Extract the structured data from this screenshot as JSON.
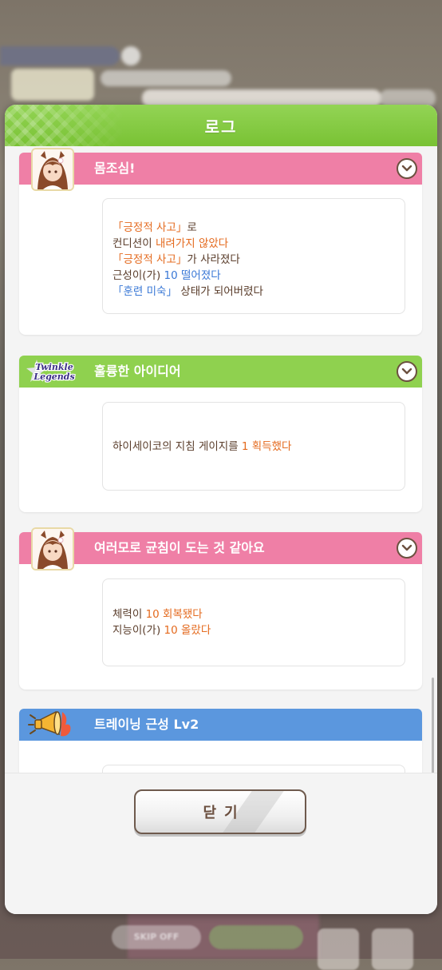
{
  "background": {
    "top_label": "목표",
    "skip_label": "SKIP OFF"
  },
  "modal": {
    "title": "로그",
    "close_label": "닫기"
  },
  "entries": [
    {
      "color": "pink",
      "icon": "character-portrait-icon",
      "title": "몸조심!",
      "lines": [
        [
          {
            "t": "「긍정적 사고」",
            "c": "o"
          },
          {
            "t": "로",
            "c": ""
          }
        ],
        [
          {
            "t": "컨디션이 ",
            "c": ""
          },
          {
            "t": "내려가지 않았다",
            "c": "o"
          }
        ],
        [
          {
            "t": "「긍정적 사고」",
            "c": "o"
          },
          {
            "t": "가 사라졌다",
            "c": ""
          }
        ],
        [
          {
            "t": "근성이(가) ",
            "c": ""
          },
          {
            "t": "10 떨어졌다",
            "c": "b"
          }
        ],
        [
          {
            "t": "「훈련 미숙」",
            "c": "b"
          },
          {
            "t": " 상태가 되어버렸다",
            "c": ""
          }
        ]
      ]
    },
    {
      "color": "green",
      "icon": "twinkle-legends-logo-icon",
      "logo_text": "Twinkle Legends",
      "title": "훌륭한 아이디어",
      "lines": [
        [
          {
            "t": "하이세이코의 지침 게이지를 ",
            "c": ""
          },
          {
            "t": "1 획득했다",
            "c": "o"
          }
        ]
      ]
    },
    {
      "color": "pink",
      "icon": "character-portrait-icon",
      "title": "여러모로 균침이 도는 것 같아요",
      "lines": [
        [
          {
            "t": "체력이 ",
            "c": ""
          },
          {
            "t": "10 회복됐다",
            "c": "o"
          }
        ],
        [
          {
            "t": "지능이(가) ",
            "c": ""
          },
          {
            "t": "10 올랐다",
            "c": "o"
          }
        ]
      ]
    },
    {
      "color": "blue",
      "icon": "megaphone-icon",
      "title": "트레이닝 근성 Lv2",
      "lines": []
    }
  ]
}
